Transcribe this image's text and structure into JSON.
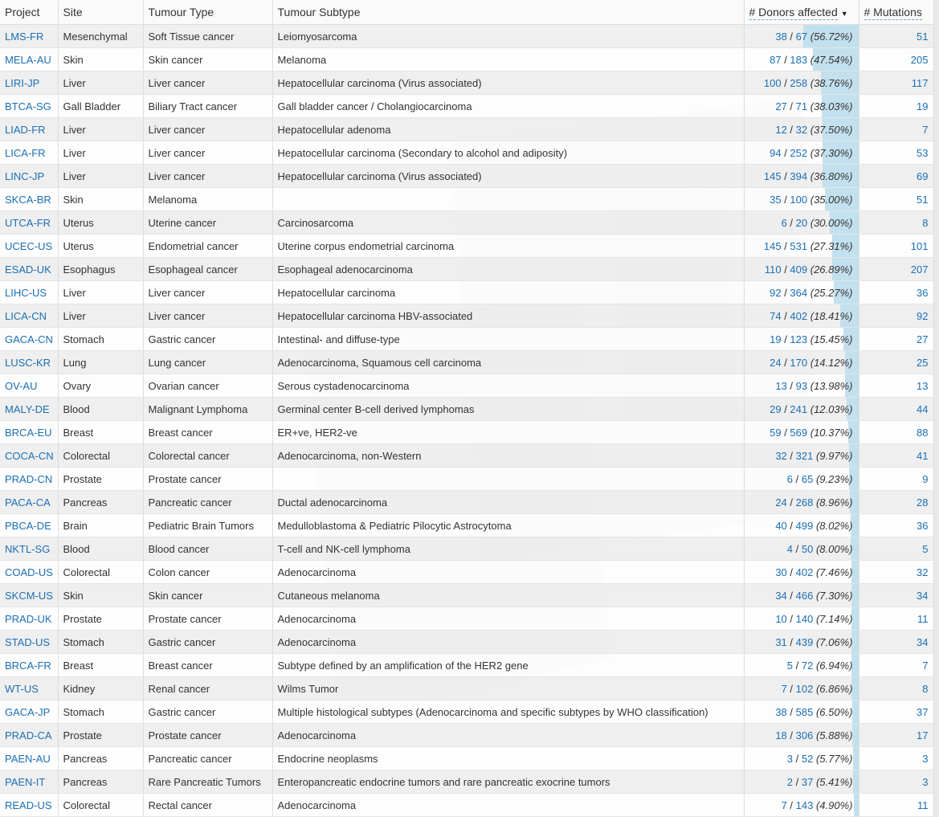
{
  "columns": {
    "project": "Project",
    "site": "Site",
    "tumour_type": "Tumour Type",
    "tumour_subtype": "Tumour Subtype",
    "donors_affected": "# Donors affected",
    "mutations": "# Mutations"
  },
  "colors": {
    "link": "#1b6fb5",
    "bar": "#c3e0ee"
  },
  "sort_icon": "caret-down-icon",
  "rows": [
    {
      "project": "LMS-FR",
      "site": "Mesenchymal",
      "type": "Soft Tissue cancer",
      "subtype": "Leiomyosarcoma",
      "affected": "38",
      "total": "67",
      "pct": "(56.72%)",
      "mutations": "51"
    },
    {
      "project": "MELA-AU",
      "site": "Skin",
      "type": "Skin cancer",
      "subtype": "Melanoma",
      "affected": "87",
      "total": "183",
      "pct": "(47.54%)",
      "mutations": "205"
    },
    {
      "project": "LIRI-JP",
      "site": "Liver",
      "type": "Liver cancer",
      "subtype": "Hepatocellular carcinoma (Virus associated)",
      "affected": "100",
      "total": "258",
      "pct": "(38.76%)",
      "mutations": "117"
    },
    {
      "project": "BTCA-SG",
      "site": "Gall Bladder",
      "type": "Biliary Tract cancer",
      "subtype": "Gall bladder cancer / Cholangiocarcinoma",
      "affected": "27",
      "total": "71",
      "pct": "(38.03%)",
      "mutations": "19"
    },
    {
      "project": "LIAD-FR",
      "site": "Liver",
      "type": "Liver cancer",
      "subtype": "Hepatocellular adenoma",
      "affected": "12",
      "total": "32",
      "pct": "(37.50%)",
      "mutations": "7"
    },
    {
      "project": "LICA-FR",
      "site": "Liver",
      "type": "Liver cancer",
      "subtype": "Hepatocellular carcinoma (Secondary to alcohol and adiposity)",
      "affected": "94",
      "total": "252",
      "pct": "(37.30%)",
      "mutations": "53"
    },
    {
      "project": "LINC-JP",
      "site": "Liver",
      "type": "Liver cancer",
      "subtype": "Hepatocellular carcinoma (Virus associated)",
      "affected": "145",
      "total": "394",
      "pct": "(36.80%)",
      "mutations": "69"
    },
    {
      "project": "SKCA-BR",
      "site": "Skin",
      "type": "Melanoma",
      "subtype": "",
      "affected": "35",
      "total": "100",
      "pct": "(35.00%)",
      "mutations": "51"
    },
    {
      "project": "UTCA-FR",
      "site": "Uterus",
      "type": "Uterine cancer",
      "subtype": "Carcinosarcoma",
      "affected": "6",
      "total": "20",
      "pct": "(30.00%)",
      "mutations": "8"
    },
    {
      "project": "UCEC-US",
      "site": "Uterus",
      "type": "Endometrial cancer",
      "subtype": "Uterine corpus endometrial carcinoma",
      "affected": "145",
      "total": "531",
      "pct": "(27.31%)",
      "mutations": "101"
    },
    {
      "project": "ESAD-UK",
      "site": "Esophagus",
      "type": "Esophageal cancer",
      "subtype": "Esophageal adenocarcinoma",
      "affected": "110",
      "total": "409",
      "pct": "(26.89%)",
      "mutations": "207"
    },
    {
      "project": "LIHC-US",
      "site": "Liver",
      "type": "Liver cancer",
      "subtype": "Hepatocellular carcinoma",
      "affected": "92",
      "total": "364",
      "pct": "(25.27%)",
      "mutations": "36"
    },
    {
      "project": "LICA-CN",
      "site": "Liver",
      "type": "Liver cancer",
      "subtype": "Hepatocellular carcinoma HBV-associated",
      "affected": "74",
      "total": "402",
      "pct": "(18.41%)",
      "mutations": "92"
    },
    {
      "project": "GACA-CN",
      "site": "Stomach",
      "type": "Gastric cancer",
      "subtype": "Intestinal- and diffuse-type",
      "affected": "19",
      "total": "123",
      "pct": "(15.45%)",
      "mutations": "27"
    },
    {
      "project": "LUSC-KR",
      "site": "Lung",
      "type": "Lung cancer",
      "subtype": "Adenocarcinoma, Squamous cell carcinoma",
      "affected": "24",
      "total": "170",
      "pct": "(14.12%)",
      "mutations": "25"
    },
    {
      "project": "OV-AU",
      "site": "Ovary",
      "type": "Ovarian cancer",
      "subtype": "Serous cystadenocarcinoma",
      "affected": "13",
      "total": "93",
      "pct": "(13.98%)",
      "mutations": "13"
    },
    {
      "project": "MALY-DE",
      "site": "Blood",
      "type": "Malignant Lymphoma",
      "subtype": "Germinal center B-cell derived lymphomas",
      "affected": "29",
      "total": "241",
      "pct": "(12.03%)",
      "mutations": "44"
    },
    {
      "project": "BRCA-EU",
      "site": "Breast",
      "type": "Breast cancer",
      "subtype": "ER+ve, HER2-ve",
      "affected": "59",
      "total": "569",
      "pct": "(10.37%)",
      "mutations": "88"
    },
    {
      "project": "COCA-CN",
      "site": "Colorectal",
      "type": "Colorectal cancer",
      "subtype": "Adenocarcinoma, non-Western",
      "affected": "32",
      "total": "321",
      "pct": "(9.97%)",
      "mutations": "41"
    },
    {
      "project": "PRAD-CN",
      "site": "Prostate",
      "type": "Prostate cancer",
      "subtype": "",
      "affected": "6",
      "total": "65",
      "pct": "(9.23%)",
      "mutations": "9"
    },
    {
      "project": "PACA-CA",
      "site": "Pancreas",
      "type": "Pancreatic cancer",
      "subtype": "Ductal adenocarcinoma",
      "affected": "24",
      "total": "268",
      "pct": "(8.96%)",
      "mutations": "28"
    },
    {
      "project": "PBCA-DE",
      "site": "Brain",
      "type": "Pediatric Brain Tumors",
      "subtype": "Medulloblastoma & Pediatric Pilocytic Astrocytoma",
      "affected": "40",
      "total": "499",
      "pct": "(8.02%)",
      "mutations": "36"
    },
    {
      "project": "NKTL-SG",
      "site": "Blood",
      "type": "Blood cancer",
      "subtype": "T-cell and NK-cell lymphoma",
      "affected": "4",
      "total": "50",
      "pct": "(8.00%)",
      "mutations": "5"
    },
    {
      "project": "COAD-US",
      "site": "Colorectal",
      "type": "Colon cancer",
      "subtype": "Adenocarcinoma",
      "affected": "30",
      "total": "402",
      "pct": "(7.46%)",
      "mutations": "32"
    },
    {
      "project": "SKCM-US",
      "site": "Skin",
      "type": "Skin cancer",
      "subtype": "Cutaneous melanoma",
      "affected": "34",
      "total": "466",
      "pct": "(7.30%)",
      "mutations": "34"
    },
    {
      "project": "PRAD-UK",
      "site": "Prostate",
      "type": "Prostate cancer",
      "subtype": "Adenocarcinoma",
      "affected": "10",
      "total": "140",
      "pct": "(7.14%)",
      "mutations": "11"
    },
    {
      "project": "STAD-US",
      "site": "Stomach",
      "type": "Gastric cancer",
      "subtype": "Adenocarcinoma",
      "affected": "31",
      "total": "439",
      "pct": "(7.06%)",
      "mutations": "34"
    },
    {
      "project": "BRCA-FR",
      "site": "Breast",
      "type": "Breast cancer",
      "subtype": "Subtype defined by an amplification of the HER2 gene",
      "affected": "5",
      "total": "72",
      "pct": "(6.94%)",
      "mutations": "7"
    },
    {
      "project": "WT-US",
      "site": "Kidney",
      "type": "Renal cancer",
      "subtype": "Wilms Tumor",
      "affected": "7",
      "total": "102",
      "pct": "(6.86%)",
      "mutations": "8"
    },
    {
      "project": "GACA-JP",
      "site": "Stomach",
      "type": "Gastric cancer",
      "subtype": "Multiple histological subtypes (Adenocarcinoma and specific subtypes by WHO classification)",
      "affected": "38",
      "total": "585",
      "pct": "(6.50%)",
      "mutations": "37"
    },
    {
      "project": "PRAD-CA",
      "site": "Prostate",
      "type": "Prostate cancer",
      "subtype": "Adenocarcinoma",
      "affected": "18",
      "total": "306",
      "pct": "(5.88%)",
      "mutations": "17"
    },
    {
      "project": "PAEN-AU",
      "site": "Pancreas",
      "type": "Pancreatic cancer",
      "subtype": "Endocrine neoplasms",
      "affected": "3",
      "total": "52",
      "pct": "(5.77%)",
      "mutations": "3"
    },
    {
      "project": "PAEN-IT",
      "site": "Pancreas",
      "type": "Rare Pancreatic Tumors",
      "subtype": "Enteropancreatic endocrine tumors and rare pancreatic exocrine tumors",
      "affected": "2",
      "total": "37",
      "pct": "(5.41%)",
      "mutations": "3"
    },
    {
      "project": "READ-US",
      "site": "Colorectal",
      "type": "Rectal cancer",
      "subtype": "Adenocarcinoma",
      "affected": "7",
      "total": "143",
      "pct": "(4.90%)",
      "mutations": "11"
    }
  ]
}
